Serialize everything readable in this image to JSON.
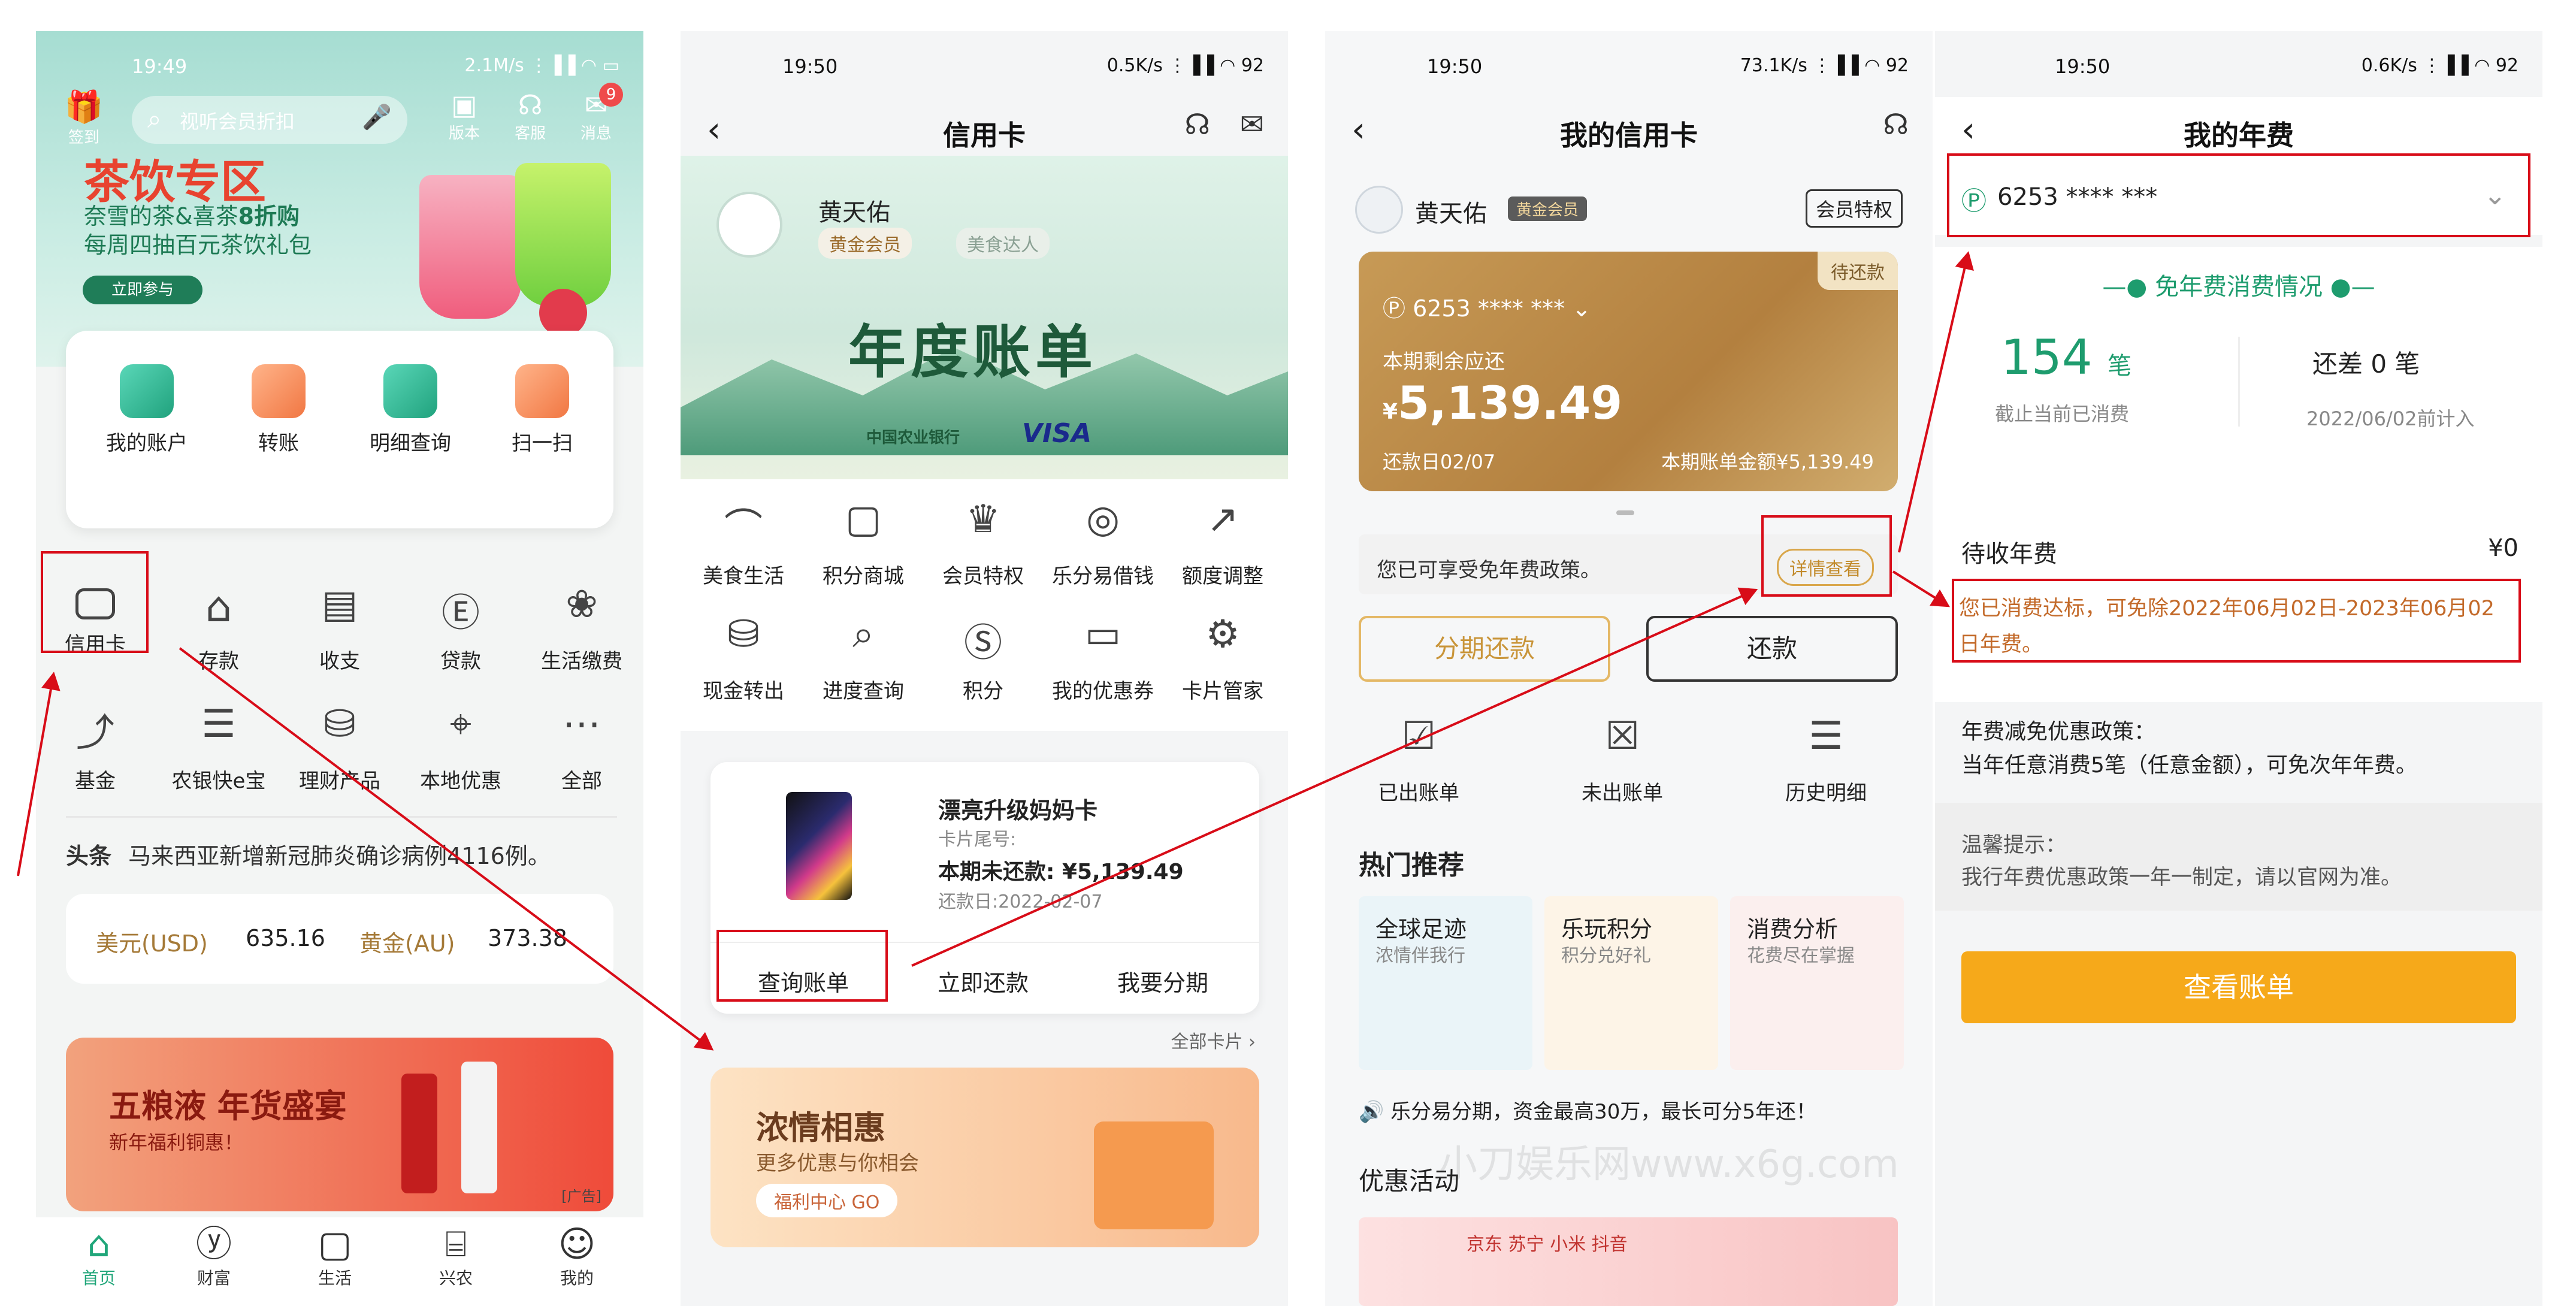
{
  "p1": {
    "status": {
      "time": "19:49",
      "right": "2.1M/s ⋮▐▐ ◠ ▭"
    },
    "search_placeholder": "视听会员折扣",
    "top_icons": [
      {
        "label": "签到"
      },
      {
        "label": "版本"
      },
      {
        "label": "客服"
      },
      {
        "label": "消息",
        "badge": "9"
      }
    ],
    "banner": {
      "title": "茶饮专区",
      "l1": "奈雪的茶&喜茶",
      "l1b": "8折购",
      "l2": "每周四抽百元茶饮礼包",
      "cta": "立即参与"
    },
    "quick": [
      "我的账户",
      "转账",
      "明细查询",
      "扫一扫"
    ],
    "grid": [
      "信用卡",
      "存款",
      "收支",
      "贷款",
      "生活缴费",
      "基金",
      "农银快e宝",
      "理财产品",
      "本地优惠",
      "全部"
    ],
    "news": {
      "tag": "头条",
      "text": "马来西亚新增新冠肺炎确诊病例4116例。"
    },
    "fx": {
      "usd_label": "美元(USD)",
      "usd": "635.16",
      "au_label": "黄金(AU)",
      "au": "373.38"
    },
    "ad": {
      "title": "五粮液 年货盛宴",
      "sub": "新年福利铜惠！",
      "tag": "[广告]"
    },
    "tabs": [
      "首页",
      "财富",
      "生活",
      "兴农",
      "我的"
    ]
  },
  "p2": {
    "status": {
      "time": "19:50",
      "right": "0.5K/s ⋮▐▐ ◠ 92"
    },
    "title": "信用卡",
    "user": {
      "name": "黄天佑",
      "tag1": "黄金会员",
      "tag2": "美食达人"
    },
    "banner": {
      "title": "年度账单",
      "bank": "中国农业银行",
      "visa": "VISA"
    },
    "row1": [
      "美食生活",
      "积分商城",
      "会员特权",
      "乐分易借钱",
      "额度调整"
    ],
    "row2": [
      "现金转出",
      "进度查询",
      "积分",
      "我的优惠券",
      "卡片管家"
    ],
    "card": {
      "name": "漂亮升级妈妈卡",
      "tail": "卡片尾号:",
      "due": "本期未还款: ¥5,139.49",
      "date": "还款日:2022-02-07"
    },
    "actions": [
      "查询账单",
      "立即还款",
      "我要分期"
    ],
    "all_cards": "全部卡片",
    "promo": {
      "title": "浓情相惠",
      "sub": "更多优惠与你相会",
      "btn": "福利中心 GO"
    }
  },
  "p3": {
    "status": {
      "time": "19:50",
      "right": "73.1K/s ⋮▐▐ ◠ 92"
    },
    "title": "我的信用卡",
    "user": {
      "name": "黄天佑",
      "tag": "黄金会员",
      "priv": "会员特权"
    },
    "card": {
      "badge": "待还款",
      "num": "6253 **** ***",
      "remain_label": "本期剩余应还",
      "amount": "5,139.49",
      "due": "还款日02/07",
      "total": "本期账单金额¥5,139.49"
    },
    "notice": {
      "text": "您已可享受免年费政策。",
      "btn": "详情查看"
    },
    "btns": {
      "install": "分期还款",
      "pay": "还款"
    },
    "bills": [
      "已出账单",
      "未出账单",
      "历史明细"
    ],
    "hot_title": "热门推荐",
    "hot": [
      {
        "t": "全球足迹",
        "s": "浓情伴我行"
      },
      {
        "t": "乐玩积分",
        "s": "积分兑好礼"
      },
      {
        "t": "消费分析",
        "s": "花费尽在掌握"
      }
    ],
    "ticker": "乐分易分期，资金最高30万，最长可分5年还！",
    "watermark": "小刀娱乐网www.x6g.com",
    "promo_title": "优惠活动",
    "promo_brands": "京东 苏宁 小米 抖音"
  },
  "p4": {
    "status": {
      "time": "19:50",
      "right": "0.6K/s ⋮▐▐ ◠ 92"
    },
    "title": "我的年费",
    "card_num": "6253 **** ***",
    "section_title": "免年费消费情况",
    "count": "154",
    "count_unit": "笔",
    "count_label": "截止当前已消费",
    "remain": "还差 0 笔",
    "remain_label": "2022/06/02前计入",
    "fee_label": "待收年费",
    "fee": "¥0",
    "msg": "您已消费达标，可免除2022年06月02日-2023年06月02日年费。",
    "policy_title": "年费减免优惠政策：",
    "policy": "当年任意消费5笔（任意金额），可免次年年费。",
    "tip_title": "温馨提示：",
    "tip": "我行年费优惠政策一年一制定，请以官网为准。",
    "btn": "查看账单"
  },
  "colors": {
    "accent_green": "#21a67a",
    "annotation_red": "#d80c18",
    "gold": "#c99a45",
    "orange_btn": "#f6a91a"
  }
}
